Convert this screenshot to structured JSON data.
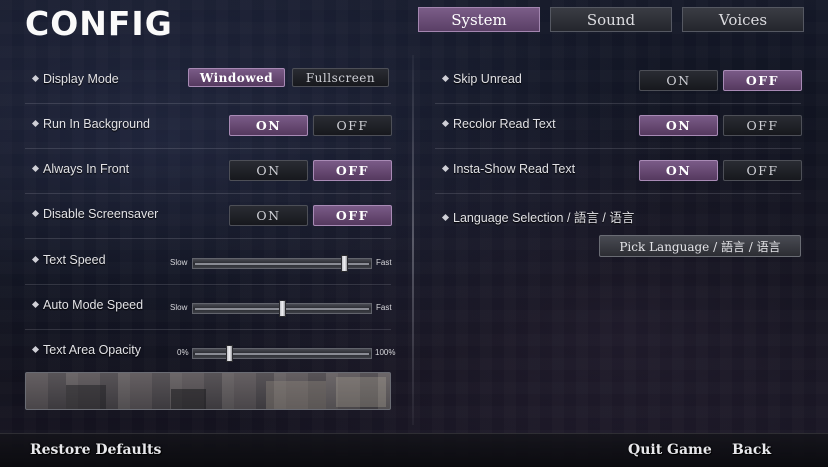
{
  "title": "CONFIG",
  "tabs": [
    {
      "label": "System",
      "active": true
    },
    {
      "label": "Sound",
      "active": false
    },
    {
      "label": "Voices",
      "active": false
    }
  ],
  "left": {
    "display_mode": {
      "label": "Display Mode",
      "options": [
        "Windowed",
        "Fullscreen"
      ],
      "selected": "Windowed"
    },
    "run_in_background": {
      "label": "Run In Background",
      "on": "ON",
      "off": "OFF",
      "value": "ON"
    },
    "always_in_front": {
      "label": "Always In Front",
      "on": "ON",
      "off": "OFF",
      "value": "OFF"
    },
    "disable_screensaver": {
      "label": "Disable Screensaver",
      "on": "ON",
      "off": "OFF",
      "value": "OFF"
    },
    "text_speed": {
      "label": "Text Speed",
      "min_label": "Slow",
      "max_label": "Fast",
      "value": 0.85
    },
    "auto_mode_speed": {
      "label": "Auto Mode Speed",
      "min_label": "Slow",
      "max_label": "Fast",
      "value": 0.5
    },
    "text_area_opacity": {
      "label": "Text Area Opacity",
      "min_label": "0%",
      "max_label": "100%",
      "value": 0.2
    }
  },
  "right": {
    "skip_unread": {
      "label": "Skip Unread",
      "on": "ON",
      "off": "OFF",
      "value": "OFF"
    },
    "recolor_read_text": {
      "label": "Recolor Read Text",
      "on": "ON",
      "off": "OFF",
      "value": "ON"
    },
    "insta_show_read_text": {
      "label": "Insta-Show Read Text",
      "on": "ON",
      "off": "OFF",
      "value": "ON"
    },
    "language_selection": {
      "label": "Language Selection / 語言 / 语言",
      "button": "Pick Language / 語言 / 语言"
    }
  },
  "footer": {
    "restore_defaults": "Restore Defaults",
    "quit_game": "Quit Game",
    "back": "Back"
  },
  "colors": {
    "accent": "#6b4d78",
    "accent_border": "#a386b0"
  }
}
